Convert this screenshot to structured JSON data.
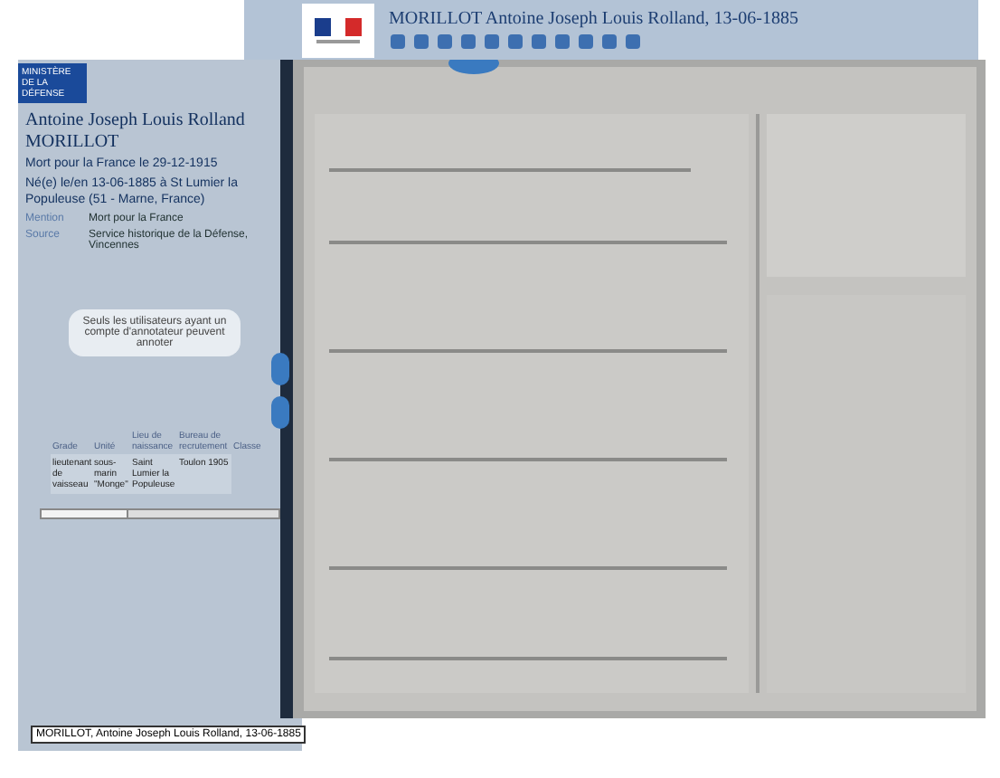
{
  "header": {
    "title": "MORILLOT Antoine Joseph Louis Rolland, 13-06-1885"
  },
  "sidebar": {
    "badge": "MINISTÈRE DE LA DÉFENSE",
    "name": "Antoine Joseph Louis Rolland MORILLOT",
    "subtitle": "Mort pour la France le 29-12-1915",
    "birth": "Né(e) le/en 13-06-1885 à St Lumier la Populeuse (51 - Marne, France)",
    "facts": [
      {
        "label": "Mention",
        "value": "Mort pour la France"
      },
      {
        "label": "Source",
        "value": "Service historique de la Défense, Vincennes"
      }
    ],
    "notice": "Seuls les utilisateurs ayant un compte d'annotateur peuvent annoter",
    "table": {
      "columns": [
        "Grade",
        "Unité",
        "Lieu de naissance",
        "Bureau de recrutement",
        "Classe"
      ],
      "rows": [
        [
          "lieutenant de vaisseau",
          "sous-marin \"Monge\"",
          "Saint Lumier la Populeuse",
          "Toulon 1905"
        ]
      ]
    }
  },
  "footer": {
    "caption": "MORILLOT, Antoine Joseph Louis Rolland, 13-06-1885"
  }
}
